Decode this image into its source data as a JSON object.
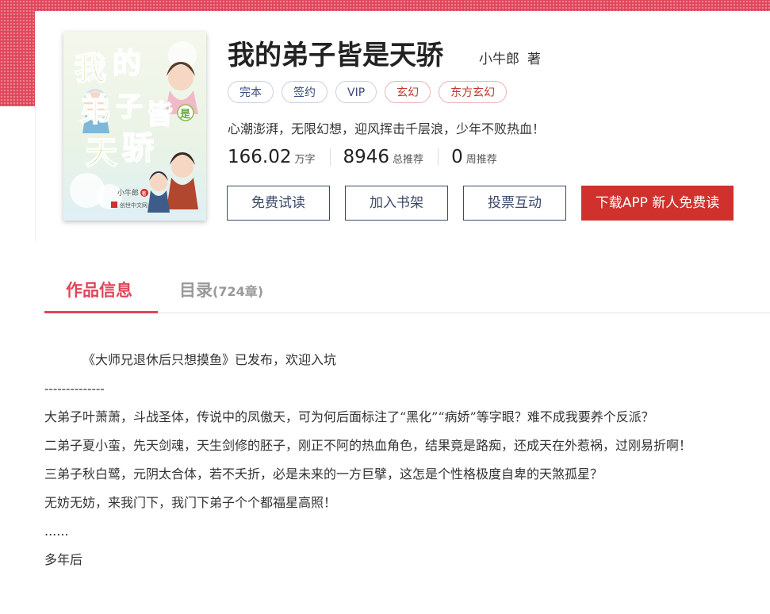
{
  "book": {
    "title": "我的弟子皆是天骄",
    "author": "小牛郎",
    "author_suffix": "著",
    "cover_text": {
      "title_art": "我的弟子皆是天骄",
      "author_mark": "小牛郎",
      "seal": "著",
      "publisher": "创世中文网"
    },
    "tags": [
      "完本",
      "签约",
      "VIP",
      "玄幻",
      "东方玄幻"
    ],
    "intro": "心潮澎湃，无限幻想，迎风挥击千层浪，少年不败热血！",
    "stats": [
      {
        "value": "166.02",
        "unit": "万字"
      },
      {
        "value": "8946",
        "unit": "总推荐"
      },
      {
        "value": "0",
        "unit": "周推荐"
      }
    ],
    "buttons": {
      "free_read": "免费试读",
      "add_shelf": "加入书架",
      "vote": "投票互动",
      "download": "下载APP  新人免费读"
    }
  },
  "tabs": {
    "info": "作品信息",
    "catalog": "目录",
    "catalog_count": "(724章)"
  },
  "description": [
    "《大师兄退休后只想摸鱼》已发布，欢迎入坑",
    "--------------",
    "大弟子叶萧萧，斗战圣体，传说中的凤傲天，可为何后面标注了“黑化”“病娇”等字眼？难不成我要养个反派？",
    "二弟子夏小蛮，先天剑魂，天生剑修的胚子，刚正不阿的热血角色，结果竟是路痴，还成天在外惹祸，过刚易折啊！",
    "三弟子秋白鹭，元阴太合体，若不夭折，必是未来的一方巨擘，这怎是个性格极度自卑的天煞孤星？",
    "无妨无妨，来我门下，我门下弟子个个都福星高照！",
    "......",
    "多年后"
  ],
  "colors": {
    "accent": "#e0455a",
    "button_primary": "#d0312d",
    "button_border": "#3b4a6b"
  }
}
